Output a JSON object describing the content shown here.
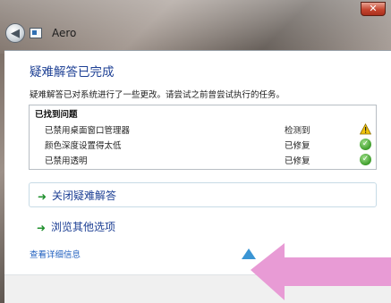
{
  "window": {
    "title": "Aero",
    "close_glyph": "✕"
  },
  "page": {
    "heading": "疑难解答已完成",
    "description": "疑难解答已对系统进行了一些更改。请尝试之前曾尝试执行的任务。"
  },
  "problems": {
    "header": "已找到问题",
    "rows": [
      {
        "name": "已禁用桌面窗口管理器",
        "status": "检测到",
        "icon": "warning-icon"
      },
      {
        "name": "颜色深度设置得太低",
        "status": "已修复",
        "icon": "check-icon"
      },
      {
        "name": "已禁用透明",
        "status": "已修复",
        "icon": "check-icon"
      }
    ]
  },
  "options": [
    {
      "label": "关闭疑难解答"
    },
    {
      "label": "浏览其他选项"
    }
  ],
  "details_link": "查看详细信息",
  "colors": {
    "heading": "#1c3f94",
    "link": "#1f5fbf",
    "ok_green": "#3d9c2a",
    "warning_yellow": "#f1c40f",
    "overlay_pink": "#e89bd5"
  }
}
